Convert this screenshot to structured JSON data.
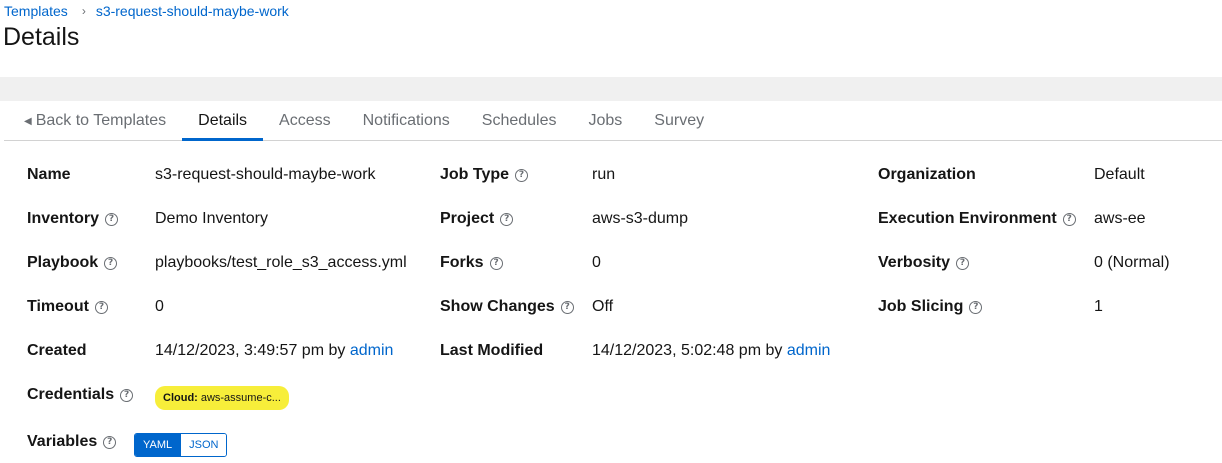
{
  "breadcrumb": {
    "root": "Templates",
    "current": "s3-request-should-maybe-work"
  },
  "page": {
    "title": "Details"
  },
  "tabs": [
    {
      "label": "Back to Templates"
    },
    {
      "label": "Details"
    },
    {
      "label": "Access"
    },
    {
      "label": "Notifications"
    },
    {
      "label": "Schedules"
    },
    {
      "label": "Jobs"
    },
    {
      "label": "Survey"
    }
  ],
  "details": {
    "name": {
      "label": "Name",
      "value": "s3-request-should-maybe-work"
    },
    "job_type": {
      "label": "Job Type",
      "value": "run"
    },
    "organization": {
      "label": "Organization",
      "value": "Default"
    },
    "inventory": {
      "label": "Inventory",
      "value": "Demo Inventory"
    },
    "project": {
      "label": "Project",
      "value": "aws-s3-dump"
    },
    "execution_environment": {
      "label": "Execution Environment",
      "value": "aws-ee"
    },
    "playbook": {
      "label": "Playbook",
      "value": "playbooks/test_role_s3_access.yml"
    },
    "forks": {
      "label": "Forks",
      "value": "0"
    },
    "verbosity": {
      "label": "Verbosity",
      "value": "0 (Normal)"
    },
    "timeout": {
      "label": "Timeout",
      "value": "0"
    },
    "show_changes": {
      "label": "Show Changes",
      "value": "Off"
    },
    "job_slicing": {
      "label": "Job Slicing",
      "value": "1"
    },
    "created": {
      "label": "Created",
      "date": "14/12/2023, 3:49:57 pm by",
      "user": "admin"
    },
    "last_modified": {
      "label": "Last Modified",
      "date": "14/12/2023, 5:02:48 pm by",
      "user": "admin"
    },
    "credentials": {
      "label": "Credentials",
      "kind": "Cloud:",
      "name": "aws-assume-c..."
    },
    "variables": {
      "label": "Variables",
      "yaml": "YAML",
      "json": "JSON"
    }
  },
  "help_glyph": "?",
  "colors": {
    "link": "#0066cc",
    "highlight": "#f7ee3a",
    "tab_active": "#0066cc"
  }
}
